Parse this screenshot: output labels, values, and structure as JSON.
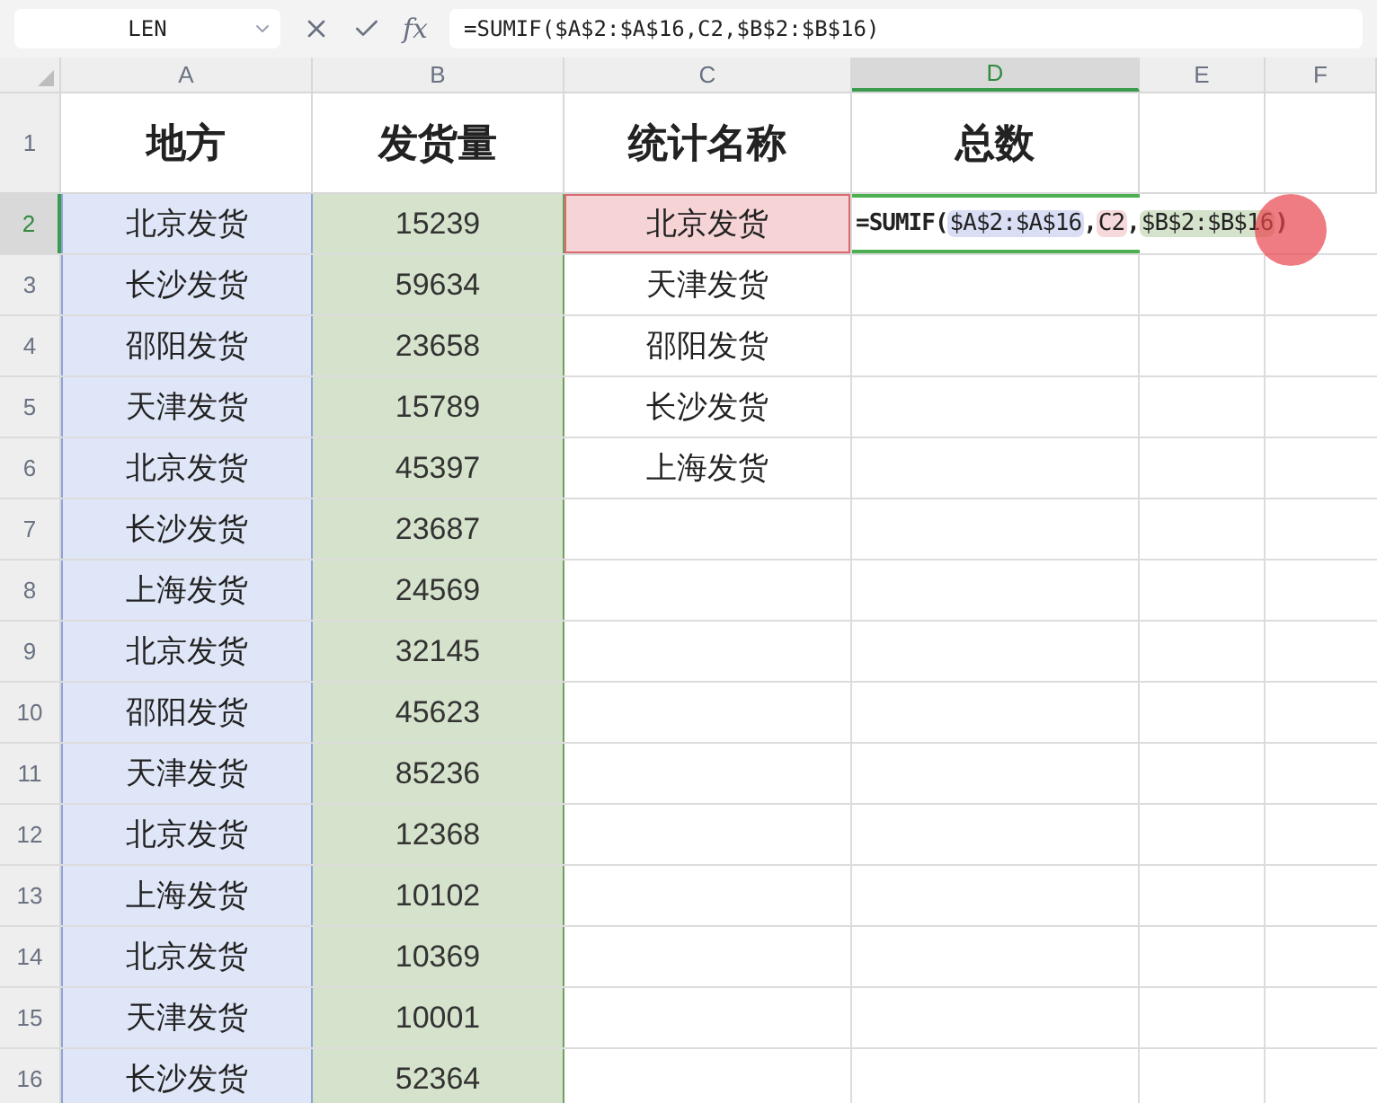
{
  "name_box": {
    "value": "LEN"
  },
  "formula_bar": {
    "fx": "fx",
    "value": "=SUMIF($A$2:$A$16,C2,$B$2:$B$16)"
  },
  "columns": [
    {
      "label": "A",
      "selected": false,
      "color": "#dfe6f7"
    },
    {
      "label": "B",
      "selected": false,
      "color": "#d6e3cc"
    },
    {
      "label": "C",
      "selected": false
    },
    {
      "label": "D",
      "selected": true
    },
    {
      "label": "E",
      "selected": false
    },
    {
      "label": "F",
      "selected": false
    }
  ],
  "header_row": {
    "number": "1",
    "cells": [
      "地方",
      "发货量",
      "统计名称",
      "总数"
    ]
  },
  "rows": [
    {
      "number": "2",
      "selected": true,
      "place": "北京发货",
      "amount": "15239",
      "stat_name": "北京发货",
      "color": "#f6d3d5",
      "formula": [
        {
          "kind": "plain",
          "text": "=SUMIF("
        },
        {
          "kind": "ref",
          "text": "$A$2:$A$16",
          "color": "#d9def5"
        },
        {
          "kind": "plain",
          "text": ","
        },
        {
          "kind": "ref",
          "text": "C2",
          "color": "#f6d9da"
        },
        {
          "kind": "plain",
          "text": ","
        },
        {
          "kind": "ref",
          "text": "$B$2:$B$16",
          "color": "#d6e3cc"
        },
        {
          "kind": "plain",
          "text": ")"
        }
      ]
    },
    {
      "number": "3",
      "selected": false,
      "place": "长沙发货",
      "amount": "59634",
      "stat_name": "天津发货"
    },
    {
      "number": "4",
      "selected": false,
      "place": "邵阳发货",
      "amount": "23658",
      "stat_name": "邵阳发货"
    },
    {
      "number": "5",
      "selected": false,
      "place": "天津发货",
      "amount": "15789",
      "stat_name": "长沙发货"
    },
    {
      "number": "6",
      "selected": false,
      "place": "北京发货",
      "amount": "45397",
      "stat_name": "上海发货"
    },
    {
      "number": "7",
      "selected": false,
      "place": "长沙发货",
      "amount": "23687"
    },
    {
      "number": "8",
      "selected": false,
      "place": "上海发货",
      "amount": "24569"
    },
    {
      "number": "9",
      "selected": false,
      "place": "北京发货",
      "amount": "32145"
    },
    {
      "number": "10",
      "selected": false,
      "place": "邵阳发货",
      "amount": "45623"
    },
    {
      "number": "11",
      "selected": false,
      "place": "天津发货",
      "amount": "85236"
    },
    {
      "number": "12",
      "selected": false,
      "place": "北京发货",
      "amount": "12368"
    },
    {
      "number": "13",
      "selected": false,
      "place": "上海发货",
      "amount": "10102"
    },
    {
      "number": "14",
      "selected": false,
      "place": "北京发货",
      "amount": "10369"
    },
    {
      "number": "15",
      "selected": false,
      "place": "天津发货",
      "amount": "10001"
    },
    {
      "number": "16",
      "selected": false,
      "place": "长沙发货",
      "amount": "52364"
    }
  ]
}
